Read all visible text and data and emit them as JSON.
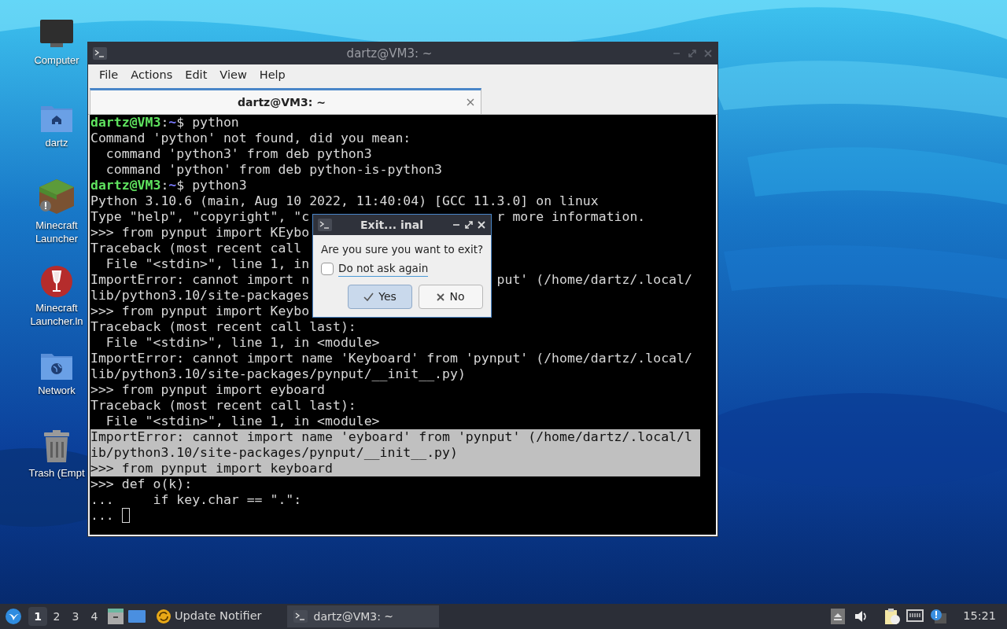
{
  "desktop_icons": [
    {
      "kind": "monitor",
      "label": "Computer"
    },
    {
      "kind": "home",
      "label": "dartz"
    },
    {
      "kind": "block",
      "label": "Minecraft Launcher"
    },
    {
      "kind": "wine",
      "label": "Minecraft Launcher.ln"
    },
    {
      "kind": "network",
      "label": "Network"
    },
    {
      "kind": "trash",
      "label": "Trash (Empt"
    }
  ],
  "terminal": {
    "title": "dartz@VM3: ~",
    "menu": [
      "File",
      "Actions",
      "Edit",
      "View",
      "Help"
    ],
    "tabs": [
      {
        "label": "dartz@VM3: ~",
        "selected": true
      }
    ],
    "lines": [
      {
        "kind": "prompt",
        "user": "dartz@VM3",
        "sep": ":",
        "path": "~",
        "text": "$ python",
        "selected": false
      },
      {
        "kind": "output",
        "text": "Command 'python' not found, did you mean:",
        "selected": false
      },
      {
        "kind": "output",
        "text": "  command 'python3' from deb python3",
        "selected": false
      },
      {
        "kind": "output",
        "text": "  command 'python' from deb python-is-python3",
        "selected": false
      },
      {
        "kind": "prompt",
        "user": "dartz@VM3",
        "sep": ":",
        "path": "~",
        "text": "$ python3",
        "selected": false
      },
      {
        "kind": "output",
        "text": "Python 3.10.6 (main, Aug 10 2022, 11:40:04) [GCC 11.3.0] on linux",
        "selected": false
      },
      {
        "kind": "output",
        "text": "Type \"help\", \"copyright\", \"c",
        "text_after": "r more information.",
        "selected": false
      },
      {
        "kind": "output",
        "text": ">>> from pynput import KEybo",
        "selected": false
      },
      {
        "kind": "output",
        "text": "Traceback (most recent call ",
        "selected": false
      },
      {
        "kind": "output",
        "text": "  File \"<stdin>\", line 1, in",
        "selected": false
      },
      {
        "kind": "output",
        "text": "ImportError: cannot import n",
        "text_after": "put' (/home/dartz/.local/",
        "selected": false
      },
      {
        "kind": "output",
        "text": "lib/python3.10/site-packages",
        "selected": false
      },
      {
        "kind": "output",
        "text": ">>> from pynput import Keybo",
        "selected": false
      },
      {
        "kind": "output",
        "text": "Traceback (most recent call last):",
        "selected": false
      },
      {
        "kind": "output",
        "text": "  File \"<stdin>\", line 1, in <module>",
        "selected": false
      },
      {
        "kind": "output",
        "text": "ImportError: cannot import name 'Keyboard' from 'pynput' (/home/dartz/.local/",
        "selected": false
      },
      {
        "kind": "output",
        "text": "lib/python3.10/site-packages/pynput/__init__.py)",
        "selected": false
      },
      {
        "kind": "output",
        "text": ">>> from pynput import eyboard",
        "selected": false
      },
      {
        "kind": "output",
        "text": "Traceback (most recent call last):",
        "selected": false
      },
      {
        "kind": "output",
        "text": "  File \"<stdin>\", line 1, in <module>",
        "selected": false
      },
      {
        "kind": "output",
        "text": "ImportError: cannot import name 'eyboard' from 'pynput' (/home/dartz/.local/l",
        "selected": true
      },
      {
        "kind": "output",
        "text": "ib/python3.10/site-packages/pynput/__init__.py)",
        "selected": true
      },
      {
        "kind": "output",
        "text": ">>> from pynput import keyboard",
        "selected": true
      },
      {
        "kind": "output",
        "text": ">>> def o(k):",
        "selected": false
      },
      {
        "kind": "output",
        "text": "...     if key.char == \".\":",
        "selected": false
      },
      {
        "kind": "input",
        "text": "... ",
        "cursor": true,
        "selected": false
      }
    ]
  },
  "dialog": {
    "title": "Exit... inal",
    "message": "Are you sure you want to exit?",
    "checkbox": {
      "label": "Do not ask again",
      "checked": false
    },
    "buttons": [
      {
        "kind": "yes",
        "label": "Yes",
        "selected": true
      },
      {
        "kind": "no",
        "label": "No",
        "selected": false
      }
    ]
  },
  "taskbar": {
    "workspaces": [
      {
        "label": "1",
        "selected": true
      },
      {
        "label": "2",
        "selected": false
      },
      {
        "label": "3",
        "selected": false
      },
      {
        "label": "4",
        "selected": false
      }
    ],
    "notifier": "Update Notifier",
    "tasks": [
      {
        "label": "dartz@VM3: ~",
        "selected": true
      }
    ],
    "clock": "15:21"
  }
}
